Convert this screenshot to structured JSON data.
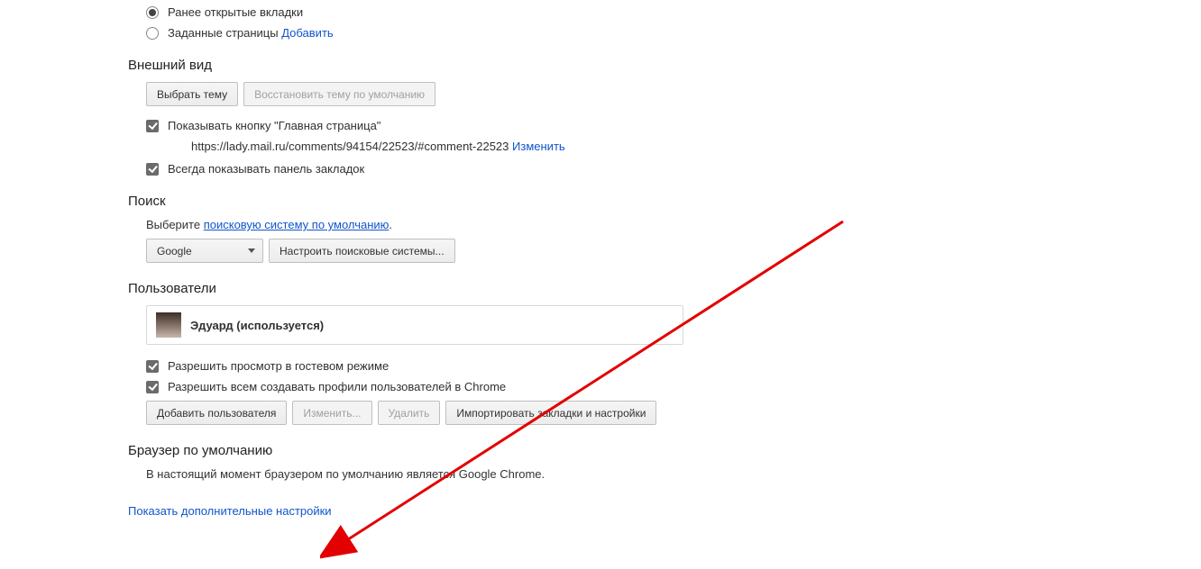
{
  "startup": {
    "radio_previous": "Ранее открытые вкладки",
    "radio_specific": "Заданные страницы",
    "add_link": "Добавить"
  },
  "appearance": {
    "title": "Внешний вид",
    "choose_theme": "Выбрать тему",
    "reset_theme": "Восстановить тему по умолчанию",
    "show_home_checkbox": "Показывать кнопку \"Главная страница\"",
    "home_url": "https://lady.mail.ru/comments/94154/22523/#comment-22523",
    "change_link": "Изменить",
    "always_show_bookmarks": "Всегда показывать панель закладок"
  },
  "search": {
    "title": "Поиск",
    "select_label": "Выберите",
    "default_engine_link": "поисковую систему по умолчанию",
    "engine_value": "Google",
    "manage_engines": "Настроить поисковые системы..."
  },
  "users": {
    "title": "Пользователи",
    "current_user": "Эдуард (используется)",
    "allow_guest": "Разрешить просмотр в гостевом режиме",
    "allow_create_profiles": "Разрешить всем создавать профили пользователей в Chrome",
    "add_user": "Добавить пользователя",
    "edit": "Изменить...",
    "delete": "Удалить",
    "import": "Импортировать закладки и настройки"
  },
  "default_browser": {
    "title": "Браузер по умолчанию",
    "status": "В настоящий момент браузером по умолчанию является Google Chrome."
  },
  "show_advanced": "Показать дополнительные настройки"
}
